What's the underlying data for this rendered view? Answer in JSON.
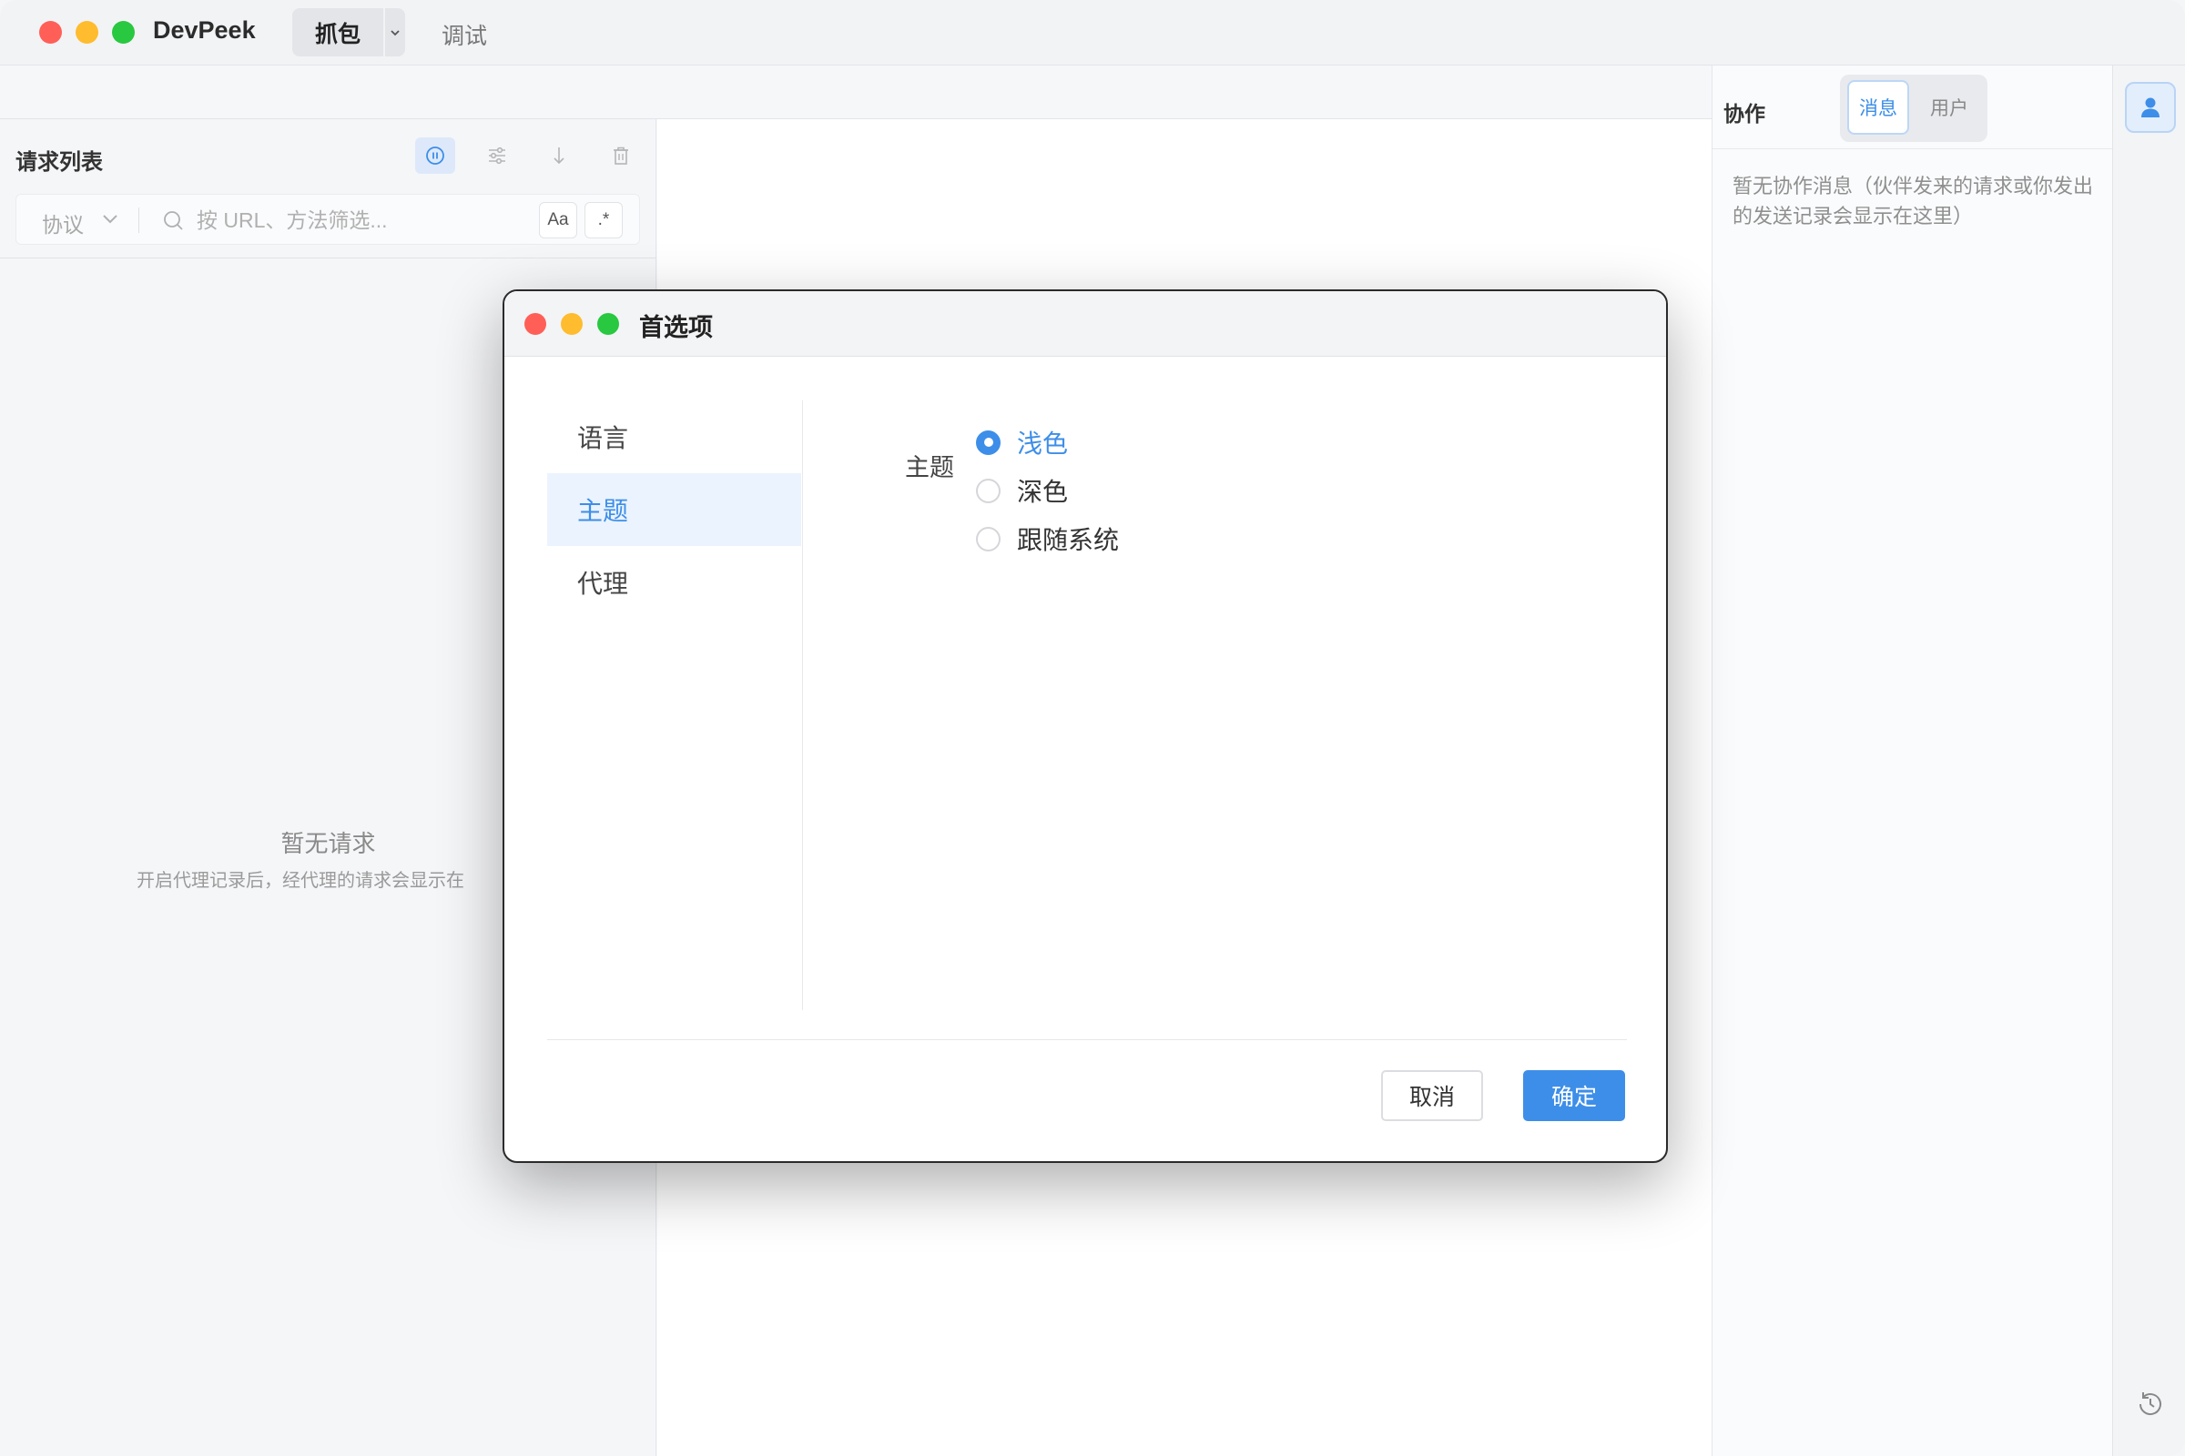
{
  "app": {
    "title": "DevPeek",
    "tabs": [
      {
        "label": "抓包",
        "active": true
      },
      {
        "label": "调试",
        "active": false
      }
    ]
  },
  "request_list": {
    "title": "请求列表",
    "toolbar_icons": [
      "pause-icon",
      "filter-settings-icon",
      "download-icon",
      "trash-icon"
    ],
    "protocol_label": "协议",
    "search_placeholder": "按 URL、方法筛选...",
    "case_toggle": "Aa",
    "regex_toggle": ".*",
    "empty_title": "暂无请求",
    "empty_subtitle": "开启代理记录后，经代理的请求会显示在"
  },
  "collab": {
    "title": "协作",
    "tabs": [
      {
        "label": "消息",
        "active": true
      },
      {
        "label": "用户",
        "active": false
      }
    ],
    "empty_text": "暂无协作消息（伙伴发来的请求或你发出的发送记录会显示在这里）"
  },
  "dialog": {
    "title": "首选项",
    "nav": [
      {
        "label": "语言",
        "active": false
      },
      {
        "label": "主题",
        "active": true
      },
      {
        "label": "代理",
        "active": false
      }
    ],
    "theme": {
      "label": "主题",
      "options": [
        {
          "label": "浅色",
          "checked": true
        },
        {
          "label": "深色",
          "checked": false
        },
        {
          "label": "跟随系统",
          "checked": false
        }
      ]
    },
    "cancel_label": "取消",
    "ok_label": "确定"
  },
  "colors": {
    "accent": "#3d8ee8",
    "close": "#ff5f57",
    "minimize": "#febc2e",
    "zoom": "#28c840"
  }
}
